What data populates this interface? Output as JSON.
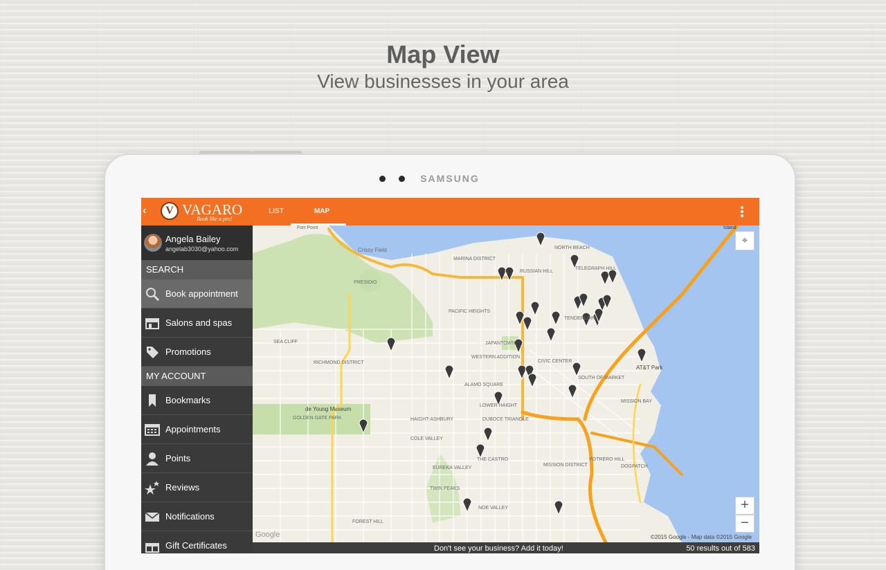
{
  "promo": {
    "title": "Map View",
    "subtitle": "View businesses in your area"
  },
  "device": {
    "brand": "SAMSUNG"
  },
  "appbar": {
    "back_icon": "‹",
    "logo_letter": "V",
    "logo_text": "VAGARO",
    "logo_tagline": "Book like a pro!",
    "tabs": [
      {
        "label": "LIST",
        "active": false
      },
      {
        "label": "MAP",
        "active": true
      }
    ],
    "accent_color": "#f36f21"
  },
  "sidebar": {
    "user": {
      "name": "Angela Bailey",
      "email": "angelab3030@yahoo.com"
    },
    "search_header": "SEARCH",
    "search_items": [
      {
        "label": "Book appointment",
        "icon": "search-icon",
        "selected": true
      },
      {
        "label": "Salons and spas",
        "icon": "storefront-icon",
        "selected": false
      },
      {
        "label": "Promotions",
        "icon": "tag-icon",
        "selected": false
      }
    ],
    "account_header": "MY ACCOUNT",
    "account_items": [
      {
        "label": "Bookmarks",
        "icon": "bookmark-icon"
      },
      {
        "label": "Appointments",
        "icon": "calendar-icon"
      },
      {
        "label": "Points",
        "icon": "person-icon"
      },
      {
        "label": "Reviews",
        "icon": "stars-icon"
      },
      {
        "label": "Notifications",
        "icon": "envelope-icon"
      },
      {
        "label": "Gift Certificates",
        "icon": "gift-icon"
      }
    ]
  },
  "map": {
    "labels": [
      "Fort Point",
      "Crissy Field",
      "MARINA DISTRICT",
      "NORTH BEACH",
      "TELEGRAPH HILL",
      "RUSSIAN HILL",
      "PRESIDIO",
      "PACIFIC HEIGHTS",
      "TENDERLOIN",
      "SEA CLIFF",
      "RICHMOND DISTRICT",
      "JAPANTOWN",
      "WESTERN ADDITION",
      "CIVIC CENTER",
      "AT&T Park",
      "ALAMO SQUARE",
      "SOUTH OF MARKET",
      "de Young Museum",
      "LOWER HAIGHT",
      "MISSION BAY",
      "GOLDEN GATE PARK",
      "HAIGHT-ASHBURY",
      "DUBOCE TRIANGLE",
      "COLE VALLEY",
      "THE CASTRO",
      "MISSION DISTRICT",
      "POTRERO HILL",
      "EUREKA VALLEY",
      "DOGPATCH",
      "TWIN PEAKS",
      "NOE VALLEY",
      "FOREST HILL",
      "Island",
      "Google"
    ],
    "copyright": "©2015 Google - Map data ©2015 Google",
    "zoom_in": "+",
    "zoom_out": "−",
    "location_icon": "crosshair-icon",
    "pin_count_shown": 40
  },
  "footer": {
    "message": "Don't see your business? Add it today!",
    "results": "50 results out of 583"
  }
}
